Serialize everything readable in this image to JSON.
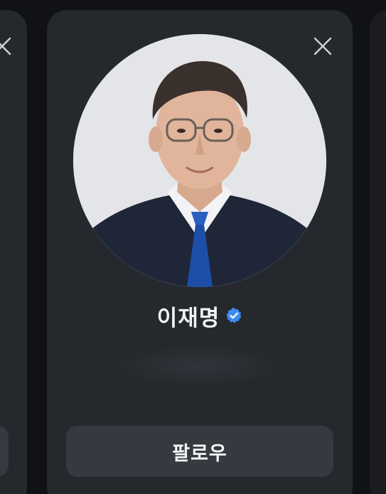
{
  "suggestion": {
    "name": "이재명",
    "verified_icon": "verified-badge-icon",
    "follow_label": "팔로우",
    "close_icon": "close-icon",
    "avatar_icon": "profile-photo"
  },
  "colors": {
    "background": "#101215",
    "card": "#25282d",
    "button": "#363a40",
    "verified": "#3d8bf2",
    "text": "#f2f2f2"
  }
}
